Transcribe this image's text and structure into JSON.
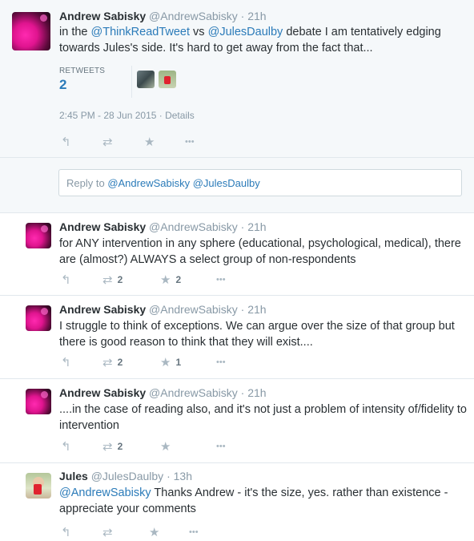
{
  "expanded": {
    "name": "Andrew Sabisky",
    "handle": "@AndrewSabisky",
    "dot": "·",
    "time": "21h",
    "text_prefix": "in the ",
    "mention1": "@ThinkReadTweet",
    "text_mid": " vs ",
    "mention2": "@JulesDaulby",
    "text_suffix": " debate I am tentatively edging",
    "text_line2": "towards Jules's side. It's hard to get away from the fact that...",
    "retweets_label": "RETWEETS",
    "retweets_count": "2",
    "timestamp": "2:45 PM - 28 Jun 2015",
    "details_sep": " · ",
    "details": "Details",
    "icons": [
      "reply-icon",
      "retweet-icon",
      "favorite-icon",
      "more-icon"
    ]
  },
  "reply_box": {
    "prefix": "Reply to ",
    "mention1": "@AndrewSabisky",
    "mention2": "@JulesDaulby"
  },
  "replies": [
    {
      "name": "Andrew Sabisky",
      "handle": "@AndrewSabisky",
      "dot": "·",
      "time": "21h",
      "line1": "for ANY intervention in any sphere (educational, psychological, medical), there",
      "line2": "are (almost?) ALWAYS a select group of non-respondents",
      "retweets": "2",
      "favorites": "2"
    },
    {
      "name": "Andrew Sabisky",
      "handle": "@AndrewSabisky",
      "dot": "·",
      "time": "21h",
      "line1": "I struggle to think of exceptions. We can argue over the size of that group but",
      "line2": "there is good reason to think that they will exist....",
      "retweets": "2",
      "favorites": "1"
    },
    {
      "name": "Andrew Sabisky",
      "handle": "@AndrewSabisky",
      "dot": "·",
      "time": "21h",
      "line1": "....in the case of reading also, and it's not just a problem of intensity of/fidelity to",
      "line2": "intervention",
      "retweets": "2",
      "favorites": ""
    },
    {
      "name": "Jules",
      "handle": "@JulesDaulby",
      "dot": "·",
      "time": "13h",
      "mention": "@AndrewSabisky",
      "line1_rest": " Thanks Andrew - it's the size, yes. rather than existence -",
      "line2": "appreciate your comments",
      "retweets": "",
      "favorites": ""
    }
  ],
  "icon_glyphs": {
    "reply": "↰",
    "retweet": "⇄",
    "favorite": "★",
    "more": "•••"
  },
  "colors": {
    "link": "#2b7bb9",
    "muted": "#8899a6",
    "text": "#292f33",
    "background_expanded": "#f5f8fa"
  }
}
